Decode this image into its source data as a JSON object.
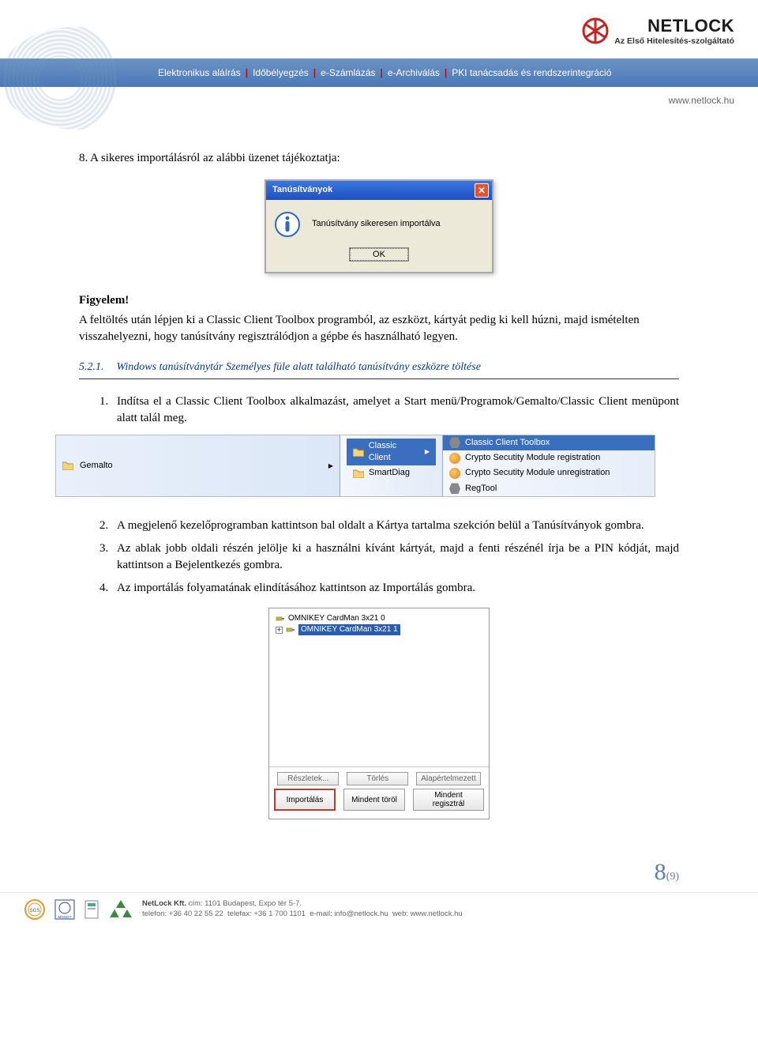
{
  "header": {
    "logo_name": "NETLOCK",
    "logo_sub": "Az Első Hitelesítés-szolgáltató",
    "nav": [
      "Elektronikus aláírás",
      "Időbélyegzés",
      "e-Számlázás",
      "e-Archiválás",
      "PKI tanácsadás és rendszerintegráció"
    ],
    "site_url": "www.netlock.hu"
  },
  "body": {
    "step8": "8.   A sikeres importálásról az alábbi üzenet tájékoztatja:",
    "dialog": {
      "title": "Tanúsítványok",
      "message": "Tanúsítvány sikeresen importálva",
      "ok": "OK"
    },
    "warn_label": "Figyelem!",
    "warn_text": "A feltöltés után lépjen ki a Classic Client Toolbox programból, az eszközt, kártyát pedig ki kell húzni, majd ismételten visszahelyezni, hogy tanúsítvány regisztrálódjon a gépbe és használható legyen.",
    "section": {
      "num": "5.2.1.",
      "title": "Windows tanúsítványtár Személyes füle alatt található tanúsítvány eszközre töltése"
    },
    "steps": [
      "Indítsa el a Classic Client Toolbox alkalmazást, amelyet a Start menü/Programok/Gemalto/Classic Client menüpont alatt talál meg.",
      "A megjelenő kezelőprogramban kattintson bal oldalt a Kártya tartalma szekción belül a Tanúsítványok gombra.",
      "Az ablak jobb oldali részén jelölje ki a használni kívánt kártyát, majd a fenti részénél írja be a PIN kódját, majd kattintson a Bejelentkezés gombra.",
      "Az importálás folyamatának elindításához kattintson az Importálás gombra."
    ],
    "menu": {
      "col1": "Gemalto",
      "col2": [
        "Classic Client",
        "SmartDiag"
      ],
      "col3": [
        "Classic Client Toolbox",
        "Crypto Secutity Module registration",
        "Crypto Secutity Module unregistration",
        "RegTool"
      ]
    },
    "cardpanel": {
      "tree": [
        "OMNIKEY CardMan 3x21 0",
        "OMNIKEY CardMan 3x21 1"
      ],
      "buttons_row1": [
        "Részletek...",
        "Törlés",
        "Alapértelmezett"
      ],
      "buttons_row2": [
        "Importálás",
        "Mindent töröl",
        "Mindent regisztrál"
      ]
    }
  },
  "page": {
    "current": "8",
    "total": "(9)"
  },
  "footer": {
    "company": "NetLock Kft.",
    "addr_label": "cím:",
    "addr": "1101 Budapest, Expo tér 5-7.",
    "tel_label": "telefon:",
    "tel": "+36 40 22 55 22",
    "fax_label": "telefax:",
    "fax": "+36 1 700 1101",
    "email_label": "e-mail:",
    "email": "info@netlock.hu",
    "web_label": "web:",
    "web": "www.netlock.hu",
    "moodys": "MOODY"
  }
}
